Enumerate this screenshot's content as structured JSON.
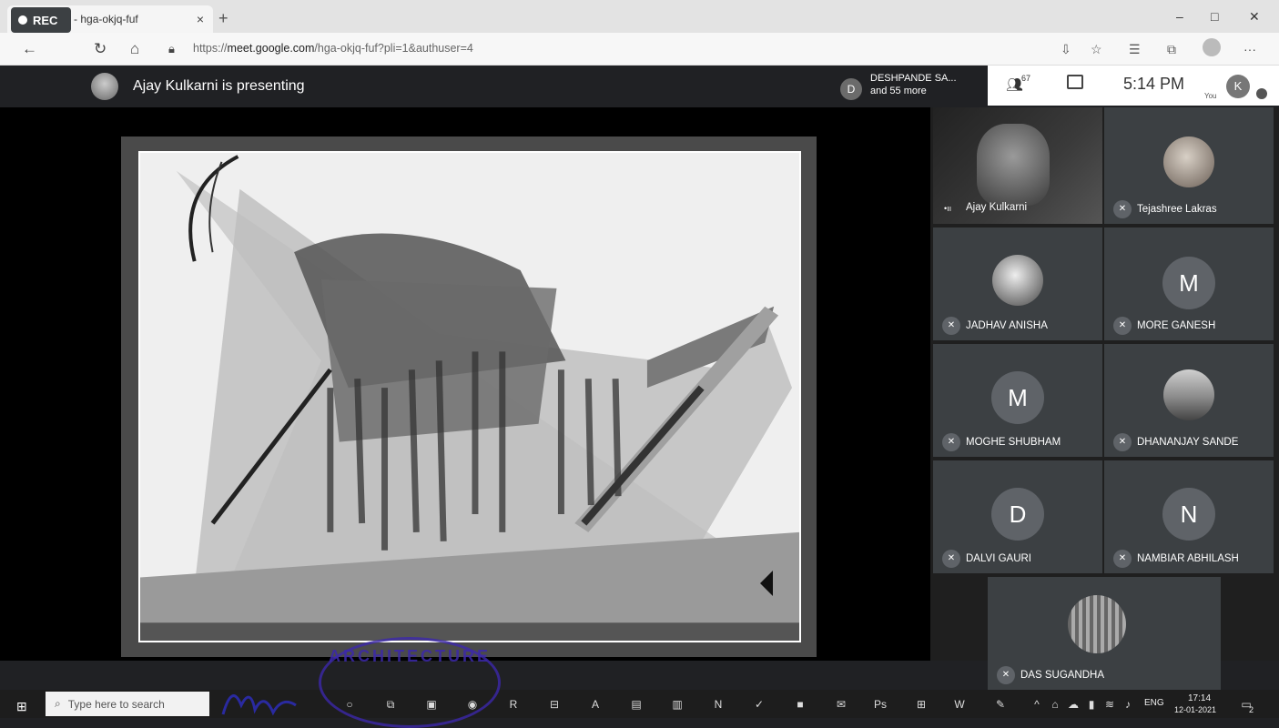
{
  "browser": {
    "tab_title": "Meet - hga-okjq-fuf",
    "tab_close": "×",
    "new_tab": "+",
    "url_prefix": "https://",
    "url_host": "meet.google.com",
    "url_path": "/hga-okjq-fuf?pli=1&authuser=4",
    "window_controls": [
      "–",
      "□",
      "✕"
    ]
  },
  "meet": {
    "rec_label": "REC",
    "presenting_text": "Ajay Kulkarni is presenting",
    "others_badge": "D",
    "others_name": "DESHPANDE SA...",
    "others_more": "and 55 more",
    "people_count": "67",
    "time": "5:14 PM",
    "you_label": "You",
    "you_avatar": "K"
  },
  "participants": [
    {
      "name": "Ajay Kulkarni",
      "type": "video",
      "mic": "speaking"
    },
    {
      "name": "Tejashree Lakras",
      "type": "photo",
      "mic": "muted"
    },
    {
      "name": "JADHAV ANISHA",
      "type": "photo",
      "mic": "muted"
    },
    {
      "name": "MORE GANESH",
      "type": "letter",
      "letter": "M",
      "mic": "muted"
    },
    {
      "name": "MOGHE SHUBHAM",
      "type": "letter",
      "letter": "M",
      "mic": "muted"
    },
    {
      "name": "DHANANJAY SANDE",
      "type": "photo",
      "mic": "muted"
    },
    {
      "name": "DALVI GAURI",
      "type": "letter",
      "letter": "D",
      "mic": "muted"
    },
    {
      "name": "NAMBIAR ABHILASH",
      "type": "letter",
      "letter": "N",
      "mic": "muted"
    },
    {
      "name": "DAS SUGANDHA",
      "type": "photo",
      "mic": "muted"
    }
  ],
  "taskbar": {
    "search_placeholder": "Type here to search",
    "lang": "ENG",
    "clock_time": "17:14",
    "clock_date": "12-01-2021",
    "notifications": "2"
  },
  "stamp_text": "ARCHITECTURE"
}
